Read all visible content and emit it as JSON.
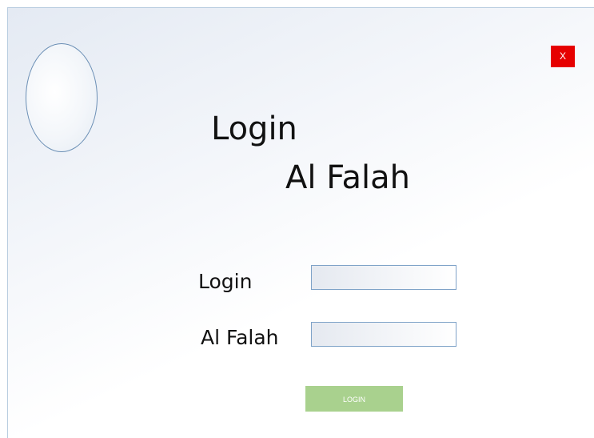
{
  "window": {
    "close_label": "X"
  },
  "header": {
    "title_line_1": "Login",
    "title_line_2": "Al Falah"
  },
  "form": {
    "field_1_label": "Login",
    "field_1_value": "",
    "field_2_label": "Al Falah",
    "field_2_value": "",
    "submit_label": "LOGIN"
  },
  "colors": {
    "close_button": "#e60000",
    "login_button": "#a9d18e",
    "input_border": "#7fa3c8",
    "logo_border": "#6b8fb5"
  },
  "icons": {
    "logo": "oval-logo-placeholder"
  }
}
